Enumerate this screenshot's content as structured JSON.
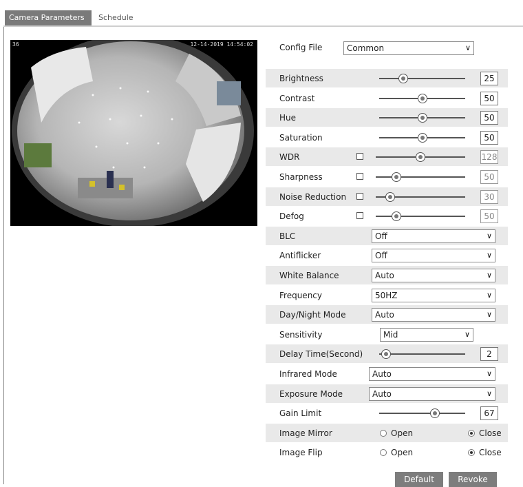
{
  "tabs": [
    {
      "label": "Camera Parameters",
      "active": true
    },
    {
      "label": "Schedule",
      "active": false
    }
  ],
  "preview": {
    "channel": "36",
    "timestamp": "12-14-2019 14:54:02"
  },
  "config_file": {
    "label": "Config File",
    "value": "Common"
  },
  "sliders": [
    {
      "label": "Brightness",
      "value": "25",
      "level": 25,
      "checkbox": false,
      "enabled": true
    },
    {
      "label": "Contrast",
      "value": "50",
      "level": 50,
      "checkbox": false,
      "enabled": true
    },
    {
      "label": "Hue",
      "value": "50",
      "level": 50,
      "checkbox": false,
      "enabled": true
    },
    {
      "label": "Saturation",
      "value": "50",
      "level": 50,
      "checkbox": false,
      "enabled": true
    },
    {
      "label": "WDR",
      "value": "128",
      "level": 50,
      "checkbox": true,
      "enabled": false
    },
    {
      "label": "Sharpness",
      "value": "50",
      "level": 20,
      "checkbox": true,
      "enabled": false
    },
    {
      "label": "Noise Reduction",
      "value": "30",
      "level": 12,
      "checkbox": true,
      "enabled": false
    },
    {
      "label": "Defog",
      "value": "50",
      "level": 20,
      "checkbox": true,
      "enabled": false
    }
  ],
  "dropdowns": [
    {
      "label": "BLC",
      "value": "Off"
    },
    {
      "label": "Antiflicker",
      "value": "Off"
    },
    {
      "label": "White Balance",
      "value": "Auto"
    },
    {
      "label": "Frequency",
      "value": "50HZ"
    },
    {
      "label": "Day/Night Mode",
      "value": "Auto"
    },
    {
      "label": "Sensitivity",
      "value": "Mid"
    }
  ],
  "delay_time": {
    "label": "Delay Time(Second)",
    "value": "2",
    "level": 3
  },
  "dropdowns2": [
    {
      "label": "Infrared Mode",
      "value": "Auto"
    },
    {
      "label": "Exposure Mode",
      "value": "Auto"
    }
  ],
  "gain_limit": {
    "label": "Gain Limit",
    "value": "67",
    "level": 67
  },
  "image_mirror": {
    "label": "Image Mirror",
    "open": "Open",
    "close": "Close",
    "selected": "Close"
  },
  "image_flip": {
    "label": "Image Flip",
    "open": "Open",
    "close": "Close",
    "selected": "Close"
  },
  "buttons": {
    "default": "Default",
    "revoke": "Revoke"
  },
  "icons": {
    "dropdown": "chevron-down-icon",
    "checkbox": "checkbox-icon",
    "radio": "radio-icon"
  }
}
